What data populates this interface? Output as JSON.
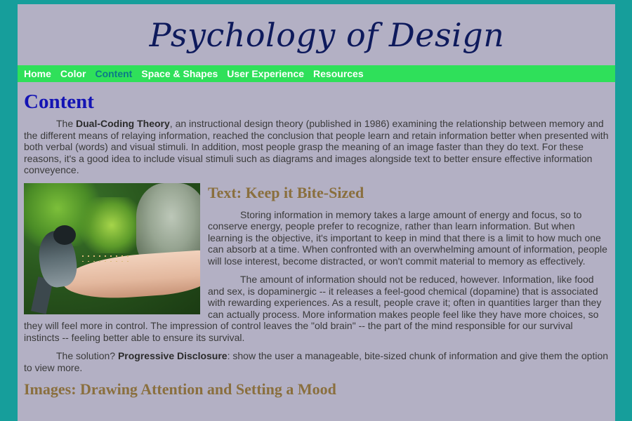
{
  "site": {
    "title": "Psychology of Design"
  },
  "nav": {
    "items": [
      {
        "label": "Home",
        "active": false
      },
      {
        "label": "Color",
        "active": false
      },
      {
        "label": "Content",
        "active": true
      },
      {
        "label": "Space & Shapes",
        "active": false
      },
      {
        "label": "User Experience",
        "active": false
      },
      {
        "label": "Resources",
        "active": false
      }
    ]
  },
  "colors": {
    "page_background": "#169e9b",
    "content_background": "#b3b0c4",
    "nav_background": "#2fe05a",
    "nav_active": "#0b7a87",
    "page_heading": "#1414b4",
    "section_heading": "#8a6f3e",
    "site_title": "#0e1a5c"
  },
  "main": {
    "heading": "Content",
    "intro": {
      "before": "The ",
      "bold": "Dual-Coding Theory",
      "after": ", an instructional design theory (published in 1986) examining the relationship between memory and the different means of relaying information, reached the conclusion that people learn and retain information better when presented with both verbal (words) and visual stimuli. In addition, most people grasp the meaning of an image faster than they do text. For these reasons, it's a good idea to include visual stimuli such as diagrams and images alongside text to better ensure effective information conveyence."
    },
    "image": {
      "icon": "bird-on-hand-photo"
    },
    "section1": {
      "heading": "Text: Keep it Bite-Sized",
      "para1": "Storing information in memory takes a large amount of energy and focus, so to conserve energy, people prefer to recognize, rather than learn information. But when learning is the objective, it's important to keep in mind that there is a limit to how much one can absorb at a time. When confronted with an overwhelming amount of information, people will lose interest, become distracted, or won't commit material to memory as effectively.",
      "para2": "The amount of information should not be reduced, however. Information, like food and sex, is dopaminergic -- it releases a feel-good chemical (dopamine) that is associated with rewarding experiences. As a result, people crave it; often in quantities larger than they can actually process. More information makes people feel like they have more choices, so they will feel more in control. The impression of control leaves the \"old brain\" -- the part of the mind responsible for our survival instincts -- feeling better able to ensure its survival.",
      "para3": {
        "before": "The solution? ",
        "bold": "Progressive Disclosure",
        "after": ": show the user a manageable, bite-sized chunk of information and give them the option to view more."
      }
    },
    "section2": {
      "heading": "Images: Drawing Attention and Setting a Mood"
    }
  }
}
